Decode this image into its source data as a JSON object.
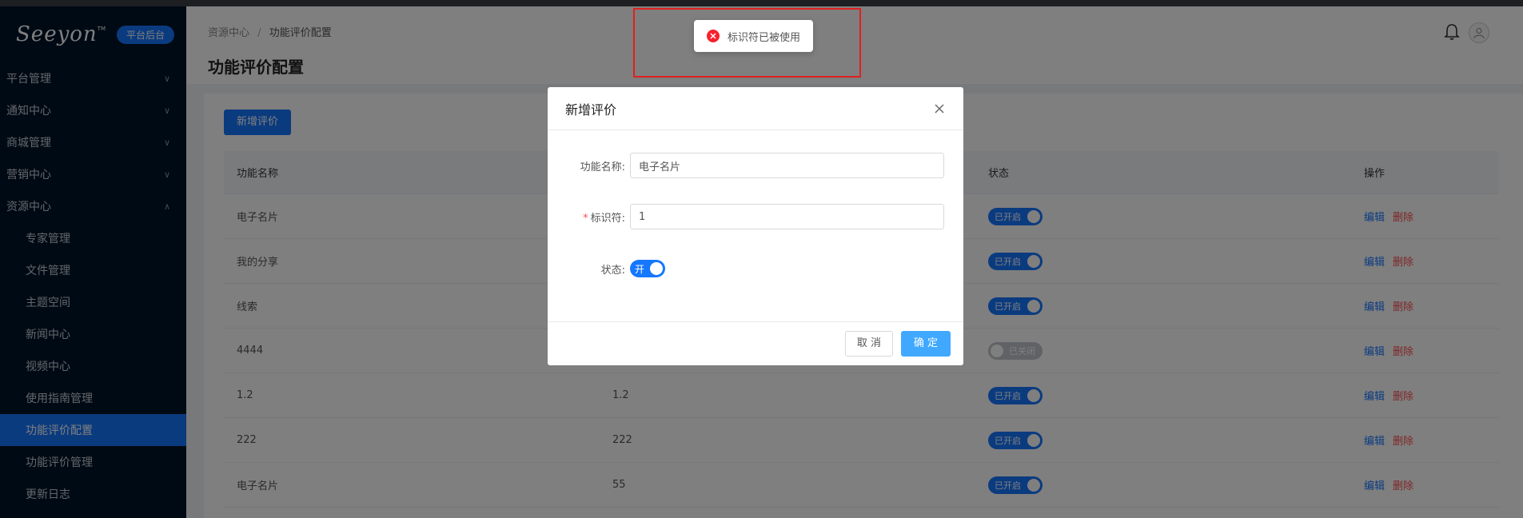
{
  "sidebar": {
    "logo": "Seeyon",
    "logo_tm": "TM",
    "badge": "平台后台",
    "menu": [
      {
        "label": "平台管理",
        "chevron": "∨"
      },
      {
        "label": "通知中心",
        "chevron": "∨"
      },
      {
        "label": "商城管理",
        "chevron": "∨"
      },
      {
        "label": "营销中心",
        "chevron": "∨"
      },
      {
        "label": "资源中心",
        "chevron": "∧"
      }
    ],
    "sub": [
      "专家管理",
      "文件管理",
      "主题空间",
      "新闻中心",
      "视频中心",
      "使用指南管理",
      "功能评价配置",
      "功能评价管理",
      "更新日志"
    ]
  },
  "header": {
    "breadcrumb_root": "资源中心",
    "breadcrumb_sep": "/",
    "breadcrumb_current": "功能评价配置",
    "title": "功能评价配置"
  },
  "content": {
    "add_button": "新增评价",
    "columns": [
      "功能名称",
      "",
      "状态",
      "操作"
    ],
    "rows": [
      {
        "name": "电子名片",
        "code": "",
        "status": "已开启",
        "on": true
      },
      {
        "name": "我的分享",
        "code": "",
        "status": "已开启",
        "on": true
      },
      {
        "name": "线索",
        "code": "",
        "status": "已开启",
        "on": true
      },
      {
        "name": "4444",
        "code": "",
        "status": "已关闭",
        "on": false
      },
      {
        "name": "1.2",
        "code": "1.2",
        "status": "已开启",
        "on": true
      },
      {
        "name": "222",
        "code": "222",
        "status": "已开启",
        "on": true
      },
      {
        "name": "电子名片",
        "code": "55",
        "status": "已开启",
        "on": true
      }
    ],
    "edit_label": "编辑",
    "delete_label": "删除"
  },
  "dialog": {
    "title": "新增评价",
    "name_label": "功能名称:",
    "name_value": "电子名片",
    "required_mark": "*",
    "code_label": "标识符:",
    "code_value": "1",
    "status_label": "状态:",
    "switch_text": "开",
    "cancel": "取 消",
    "ok": "确 定"
  },
  "toast": {
    "message": "标识符已被使用",
    "icon": "error-icon",
    "color": "#f5222d"
  },
  "colors": {
    "primary": "#1677ff",
    "sidebar_bg": "#001529",
    "danger": "#ff4d4f"
  }
}
